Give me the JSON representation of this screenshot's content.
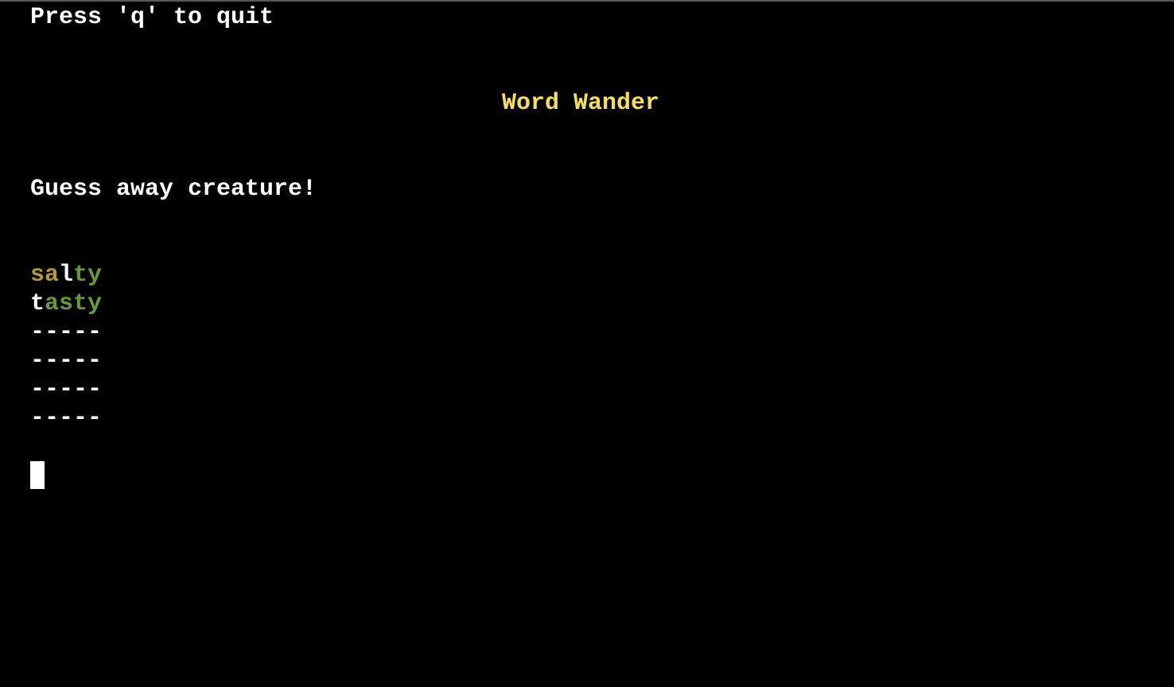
{
  "terminal": {
    "quit_hint": "Press 'q' to quit",
    "title": "Word Wander",
    "prompt": "Guess away creature!",
    "colors": {
      "background": "#000000",
      "text": "#ffffff",
      "title": "#f5e05a",
      "correct": "#6a9a35",
      "present": "#b39b3c",
      "absent": "#ffffff"
    },
    "guesses": [
      {
        "word": "salty",
        "letters": [
          {
            "char": "s",
            "status": "present"
          },
          {
            "char": "a",
            "status": "present"
          },
          {
            "char": "l",
            "status": "absent"
          },
          {
            "char": "t",
            "status": "correct"
          },
          {
            "char": "y",
            "status": "correct"
          }
        ]
      },
      {
        "word": "tasty",
        "letters": [
          {
            "char": "t",
            "status": "absent"
          },
          {
            "char": "a",
            "status": "correct"
          },
          {
            "char": "s",
            "status": "correct"
          },
          {
            "char": "t",
            "status": "correct"
          },
          {
            "char": "y",
            "status": "correct"
          }
        ]
      }
    ],
    "empty_rows": [
      "-----",
      "-----",
      "-----",
      "-----"
    ],
    "input_value": ""
  }
}
